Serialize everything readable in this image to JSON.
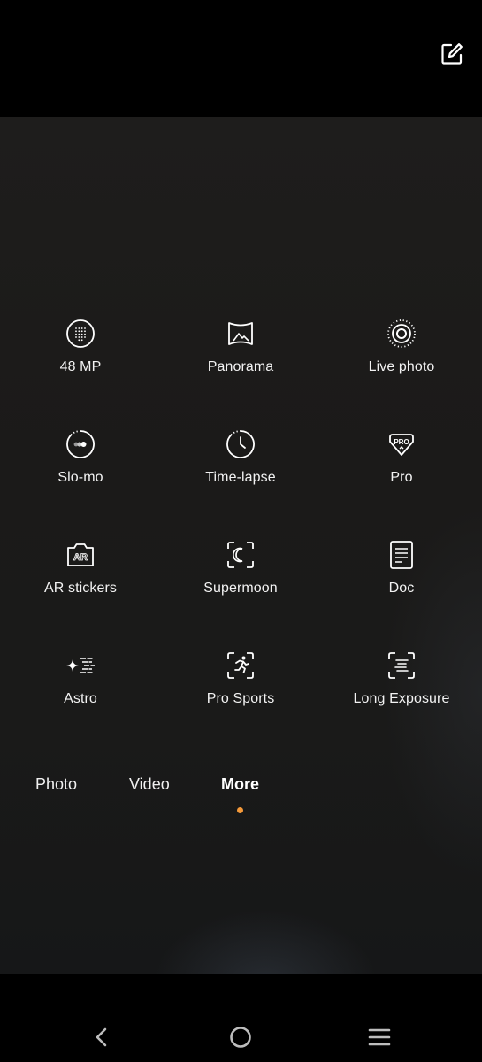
{
  "topbar": {
    "edit_icon": "edit-square-icon"
  },
  "modes": [
    {
      "id": "48mp",
      "label": "48 MP",
      "icon": "48mp-icon"
    },
    {
      "id": "panorama",
      "label": "Panorama",
      "icon": "panorama-icon"
    },
    {
      "id": "live-photo",
      "label": "Live photo",
      "icon": "live-photo-icon"
    },
    {
      "id": "slo-mo",
      "label": "Slo-mo",
      "icon": "slo-mo-icon"
    },
    {
      "id": "time-lapse",
      "label": "Time-lapse",
      "icon": "time-lapse-icon"
    },
    {
      "id": "pro",
      "label": "Pro",
      "icon": "pro-icon",
      "badge": "PRO"
    },
    {
      "id": "ar-stickers",
      "label": "AR stickers",
      "icon": "ar-icon",
      "badge": "AR"
    },
    {
      "id": "supermoon",
      "label": "Supermoon",
      "icon": "moon-icon"
    },
    {
      "id": "doc",
      "label": "Doc",
      "icon": "document-icon"
    },
    {
      "id": "astro",
      "label": "Astro",
      "icon": "astro-icon"
    },
    {
      "id": "pro-sports",
      "label": "Pro Sports",
      "icon": "runner-icon"
    },
    {
      "id": "long-exposure",
      "label": "Long Exposure",
      "icon": "long-exposure-icon"
    }
  ],
  "tabs": [
    {
      "label": "Photo",
      "active": false
    },
    {
      "label": "Video",
      "active": false
    },
    {
      "label": "More",
      "active": true
    }
  ],
  "accent_color": "#f59a3a",
  "navbar": {
    "back": "back-icon",
    "home": "home-icon",
    "menu": "menu-icon"
  }
}
